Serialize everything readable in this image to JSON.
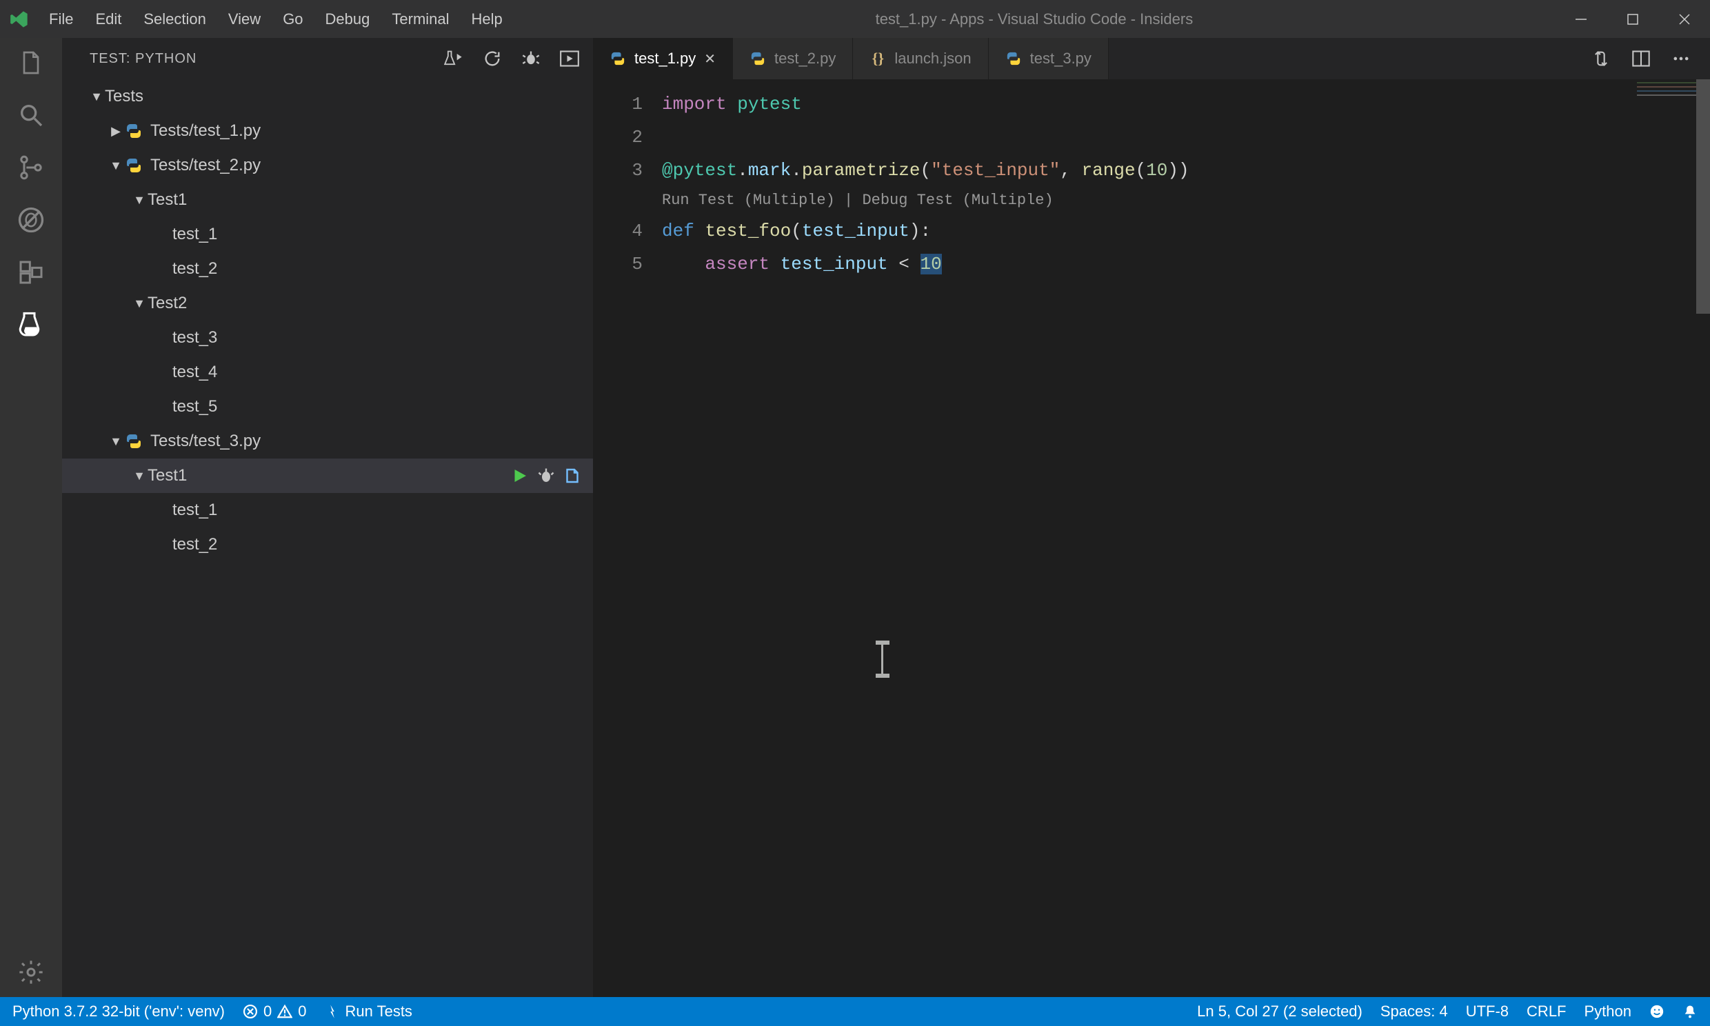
{
  "window": {
    "title": "test_1.py - Apps - Visual Studio Code - Insiders"
  },
  "menu": {
    "file": "File",
    "edit": "Edit",
    "selection": "Selection",
    "view": "View",
    "go": "Go",
    "debug": "Debug",
    "terminal": "Terminal",
    "help": "Help"
  },
  "sidebar": {
    "title": "TEST: PYTHON",
    "tree": {
      "root": "Tests",
      "files": [
        {
          "name": "Tests/test_1.py",
          "expanded": false
        },
        {
          "name": "Tests/test_2.py",
          "expanded": true,
          "suites": [
            {
              "name": "Test1",
              "tests": [
                "test_1",
                "test_2"
              ]
            },
            {
              "name": "Test2",
              "tests": [
                "test_3",
                "test_4",
                "test_5"
              ]
            }
          ]
        },
        {
          "name": "Tests/test_3.py",
          "expanded": true,
          "suites": [
            {
              "name": "Test1",
              "selected": true,
              "tests": [
                "test_1",
                "test_2"
              ]
            }
          ]
        }
      ]
    }
  },
  "tabs": [
    {
      "label": "test_1.py",
      "icon": "python",
      "active": true,
      "dirty": false
    },
    {
      "label": "test_2.py",
      "icon": "python",
      "active": false
    },
    {
      "label": "launch.json",
      "icon": "json",
      "active": false
    },
    {
      "label": "test_3.py",
      "icon": "python",
      "active": false
    }
  ],
  "editor": {
    "lines": [
      "1",
      "2",
      "3",
      "4",
      "5"
    ],
    "codelens": "Run Test (Multiple) | Debug Test (Multiple)",
    "code": {
      "l1_import": "import",
      "l1_pytest": "pytest",
      "l3_dec": "@pytest.mark.parametrize",
      "l3_str": "\"test_input\"",
      "l3_range": "range",
      "l3_num": "10",
      "l4_def": "def",
      "l4_name": "test_foo",
      "l4_param": "test_input",
      "l5_assert": "assert",
      "l5_var": "test_input",
      "l5_op": "<",
      "l5_num": "10"
    }
  },
  "status": {
    "python": "Python 3.7.2 32-bit ('env': venv)",
    "errors": "0",
    "warnings": "0",
    "run_tests": "Run Tests",
    "cursor": "Ln 5, Col 27 (2 selected)",
    "spaces": "Spaces: 4",
    "encoding": "UTF-8",
    "eol": "CRLF",
    "lang": "Python"
  }
}
